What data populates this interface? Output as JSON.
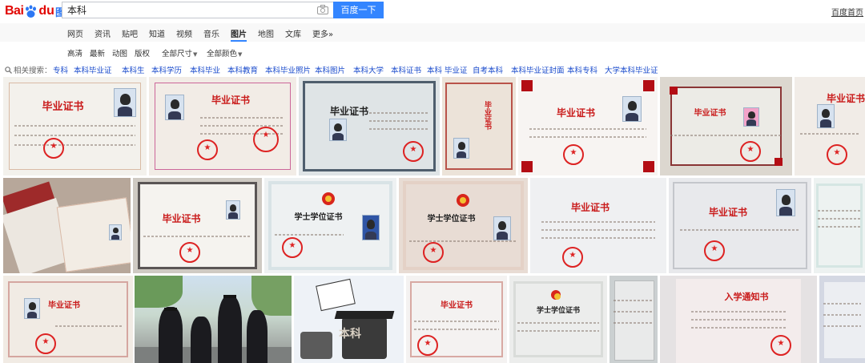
{
  "header": {
    "logo_bai": "Bai",
    "logo_du": "du",
    "logo_tupian": "图片",
    "search_value": "本科",
    "search_button": "百度一下",
    "home_link": "百度首页"
  },
  "nav_tabs": [
    "网页",
    "资讯",
    "贴吧",
    "知道",
    "视频",
    "音乐",
    "图片",
    "地图",
    "文库",
    "更多»"
  ],
  "active_tab": "图片",
  "filters": {
    "items": [
      "高清",
      "最新",
      "动图",
      "版权"
    ],
    "size": "全部尺寸",
    "color": "全部颜色"
  },
  "related": {
    "label": "相关搜索：",
    "terms": [
      "专科",
      "本科毕业证",
      "本科生",
      "本科学历",
      "本科毕业",
      "本科教育",
      "本科毕业照片",
      "本科图片",
      "本科大学",
      "本科证书",
      "本科 毕业证",
      "自考本科",
      "本科毕业证封面",
      "本科专科",
      "大学本科毕业证"
    ]
  },
  "images": {
    "row1": [
      {
        "title": "毕业证书"
      },
      {
        "title": "毕业证书"
      },
      {
        "title": "毕业证书"
      },
      {
        "title": "毕业证书"
      },
      {
        "title": "毕业证书"
      },
      {
        "title": "毕业证书"
      },
      {
        "title": "毕业证书"
      }
    ],
    "row2": [
      {
        "title": ""
      },
      {
        "title": "毕业证书"
      },
      {
        "title": "学士学位证书"
      },
      {
        "title": "学士学位证书"
      },
      {
        "title": "毕业证书"
      },
      {
        "title": "毕业证书"
      },
      {
        "title": ""
      }
    ],
    "row3": [
      {
        "title": "毕业证书"
      },
      {
        "title": ""
      },
      {
        "title": "本科"
      },
      {
        "title": "毕业证书"
      },
      {
        "title": "学士学位证书"
      },
      {
        "title": ""
      },
      {
        "title": "入学通知书"
      },
      {
        "title": ""
      }
    ]
  }
}
